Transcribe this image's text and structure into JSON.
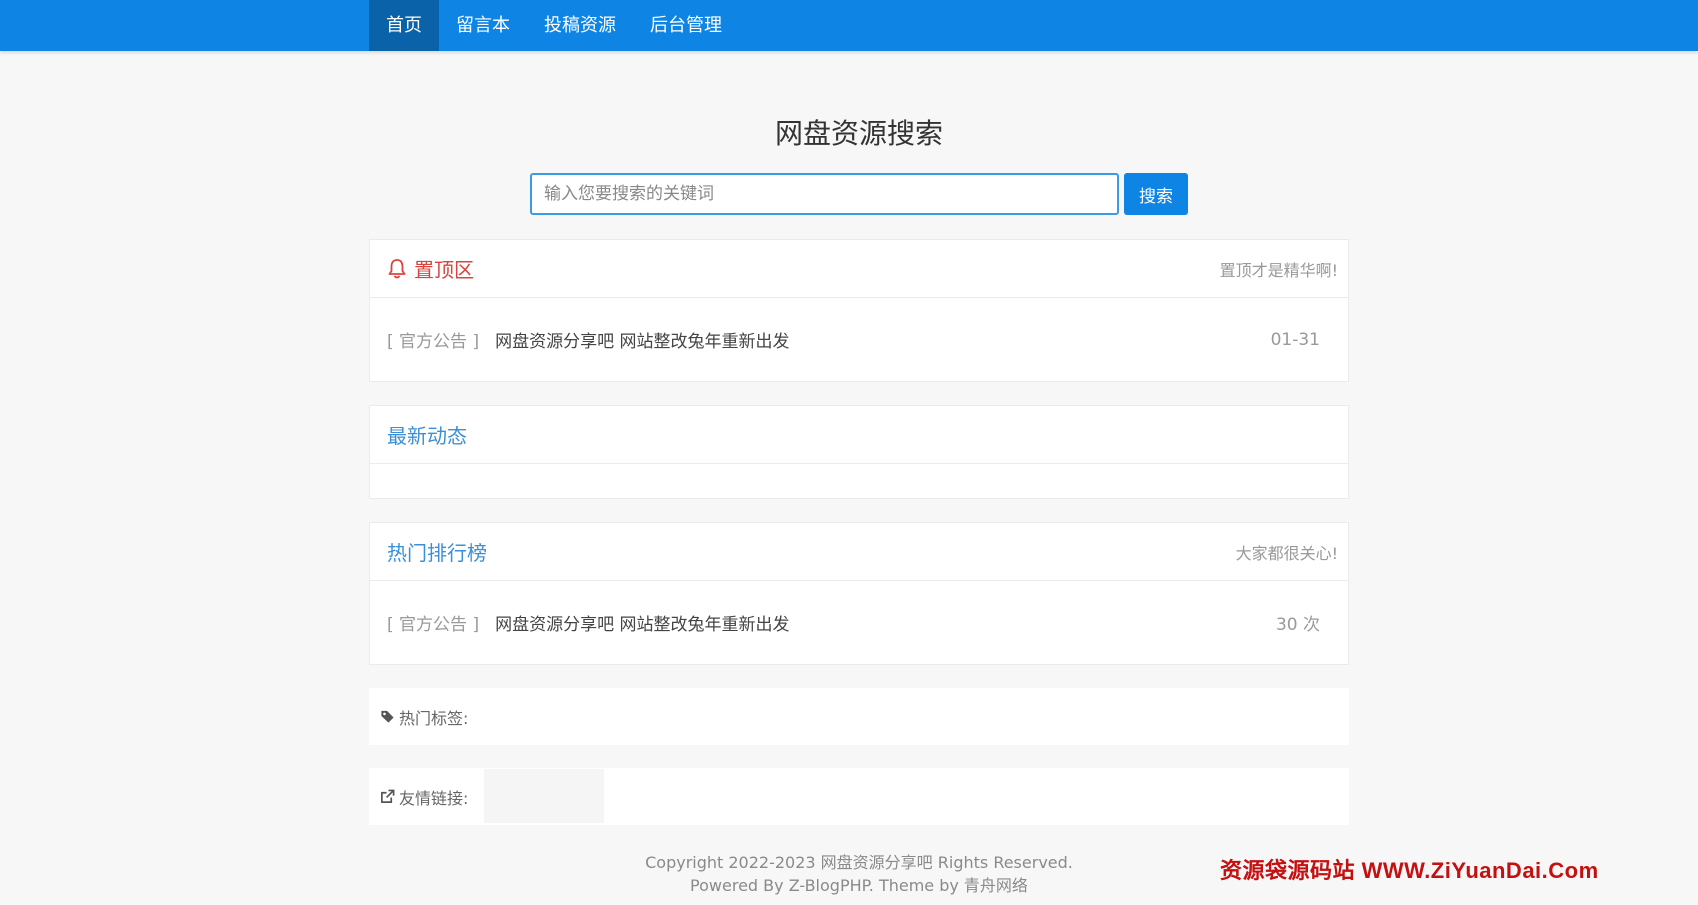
{
  "nav": {
    "items": [
      {
        "label": "首页",
        "active": true
      },
      {
        "label": "留言本",
        "active": false
      },
      {
        "label": "投稿资源",
        "active": false
      },
      {
        "label": "后台管理",
        "active": false
      }
    ]
  },
  "search": {
    "title": "网盘资源搜索",
    "placeholder": "输入您要搜索的关键词",
    "button_label": "搜索"
  },
  "pinned": {
    "title": "置顶区",
    "subtitle": "置顶才是精华啊!",
    "items": [
      {
        "tag": "[ 官方公告 ]",
        "title": "网盘资源分享吧 网站整改兔年重新出发",
        "date": "01-31"
      }
    ]
  },
  "latest": {
    "title": "最新动态"
  },
  "hot": {
    "title": "热门排行榜",
    "subtitle": "大家都很关心!",
    "items": [
      {
        "tag": "[ 官方公告 ]",
        "title": "网盘资源分享吧 网站整改兔年重新出发",
        "views": "30 次"
      }
    ]
  },
  "tags_bar": {
    "label": "热门标签:"
  },
  "links_bar": {
    "label": "友情链接:"
  },
  "footer": {
    "line1": "Copyright 2022-2023 网盘资源分享吧 Rights Reserved.",
    "line2": "Powered By Z-BlogPHP. Theme by 青舟网络"
  },
  "watermark": "资源袋源码站  WWW.ZiYuanDai.Com",
  "colors": {
    "nav_bg": "#0e85e5",
    "nav_active": "#0a62a9",
    "title_blue": "#3c8fd6",
    "pinned_red": "#d9443e"
  },
  "icons": [
    "bell-icon",
    "tag-icon",
    "external-link-icon"
  ]
}
